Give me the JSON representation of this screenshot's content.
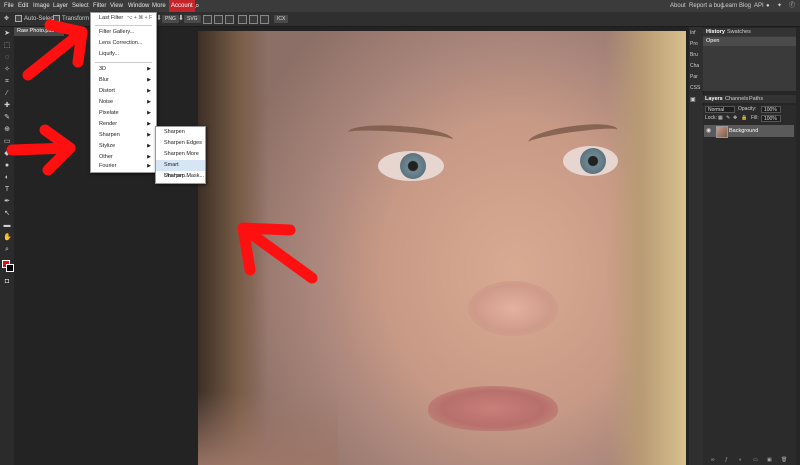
{
  "menubar": {
    "items": [
      "File",
      "Edit",
      "Image",
      "Layer",
      "Select",
      "Filter",
      "View",
      "Window",
      "More",
      "Account"
    ],
    "active": "Account",
    "right": [
      "About",
      "Report a bug",
      "Learn",
      "Blog",
      "API"
    ]
  },
  "options": {
    "auto_select": "Auto-Select",
    "transform": "Transform controls",
    "png": "PNG",
    "svg": "SVG",
    "px": "ICX"
  },
  "doc_tab": "Raw Photo.psd",
  "filter_menu": {
    "last_filter": "Last Filter",
    "last_filter_shortcut": "⌥ + ⌘ + F",
    "gallery": "Filter Gallery...",
    "lens": "Lens Correction...",
    "liquify": "Liquify...",
    "groups": [
      "3D",
      "Blur",
      "Distort",
      "Noise",
      "Pixelate",
      "Render",
      "Sharpen",
      "Stylize",
      "Other",
      "Fourier"
    ]
  },
  "sharpen_submenu": [
    "Sharpen",
    "Sharpen Edges",
    "Sharpen More",
    "Smart Sharpen...",
    "Unsharp Mask..."
  ],
  "right_strip": [
    "Inf",
    "Pro",
    "Bru",
    "Cha",
    "Par",
    "CSS"
  ],
  "history": {
    "tab1": "History",
    "tab2": "Swatches",
    "item": "Open"
  },
  "layers": {
    "tab1": "Layers",
    "tab2": "Channels",
    "tab3": "Paths",
    "blend": "Normal",
    "opacity_label": "Opacity:",
    "opacity": "100%",
    "lock_label": "Lock:",
    "fill_label": "Fill:",
    "fill": "100%",
    "layer_name": "Background"
  },
  "colors": {
    "accent": "#c4252a",
    "arrow": "#ff1010",
    "menu_bg": "#ffffff",
    "highlight": "#d6e6f5"
  }
}
